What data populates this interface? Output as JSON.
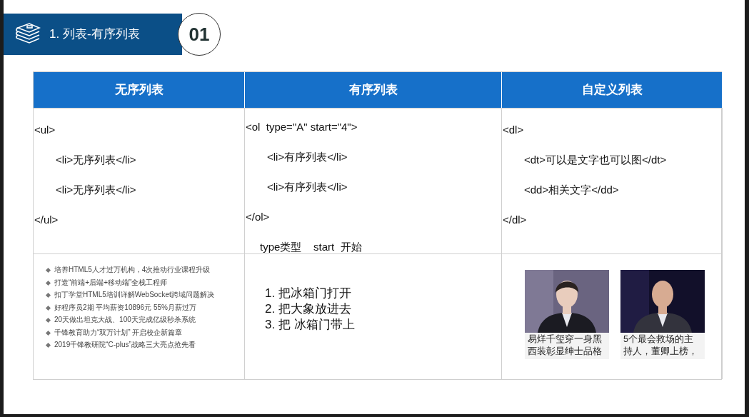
{
  "header": {
    "title": "1. 列表-有序列表",
    "number": "01"
  },
  "table": {
    "columns": [
      "无序列表",
      "有序列表",
      "自定义列表"
    ],
    "code": [
      [
        {
          "kind": "tag",
          "text": "<ul>",
          "children": [
            {
              "kind": "tag",
              "text": "<li>无序列表</li>"
            },
            {
              "kind": "tag",
              "text": "<li>无序列表</li>"
            }
          ]
        },
        {
          "kind": "tag",
          "text": "</ul>"
        }
      ],
      [
        {
          "kind": "tag",
          "text": "<ol  type=\"A\" start=\"4\">",
          "children": [
            {
              "kind": "tag",
              "text": "<li>有序列表</li>"
            },
            {
              "kind": "tag",
              "text": "<li>有序列表</li>"
            }
          ]
        },
        {
          "kind": "tag",
          "text": "</ol>"
        },
        {
          "kind": "note",
          "text": "type类型    start  开始"
        }
      ],
      [
        {
          "kind": "tag",
          "text": "<dl>",
          "children": [
            {
              "kind": "tag",
              "text": "<dt>可以是文字也可以图</dt>"
            },
            {
              "kind": "tag",
              "text": "<dd>相关文字</dd>"
            }
          ]
        },
        {
          "kind": "tag",
          "text": "</dl>"
        }
      ]
    ],
    "bullet_list": [
      "培养HTML5人才过万机构，4次推动行业课程升级",
      "打造“前端+后端+移动端”全栈工程师",
      "扣丁学堂HTML5培训详解WebSocket跨域问题解决",
      "好程序员2期 平均薪资10896元 55%月薪过万",
      "20天做出坦克大战、100天完成亿级秒杀系统",
      "千锋教育助力“双万计划” 开启校企新篇章",
      "2019千锋教研院“C-plus”战略三大亮点抢先看"
    ],
    "ordered_list": [
      "1. 把冰箱门打开",
      "2. 把大象放进去",
      "3. 把 冰箱门带上"
    ],
    "news_cards": [
      {
        "kind": "picture",
        "caption": "易烊千玺穿一身黑西装彰显绅士品格"
      },
      {
        "kind": "picture",
        "caption": "5个最会救场的主持人，董卿上榜，"
      }
    ]
  }
}
